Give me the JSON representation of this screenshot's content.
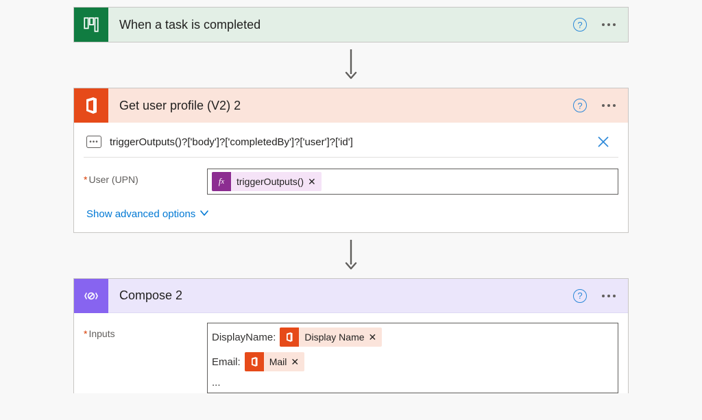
{
  "trigger": {
    "title": "When a task is completed"
  },
  "action1": {
    "title": "Get user profile (V2) 2",
    "expression": "triggerOutputs()?['body']?['completedBy']?['user']?['id']",
    "field_label": "User (UPN)",
    "token_label": "triggerOutputs()",
    "advanced_link": "Show advanced options"
  },
  "action2": {
    "title": "Compose 2",
    "field_label": "Inputs",
    "line1_label": "DisplayName:",
    "line1_token": "Display Name",
    "line2_label": "Email:",
    "line2_token": "Mail",
    "ellipsis": "..."
  }
}
